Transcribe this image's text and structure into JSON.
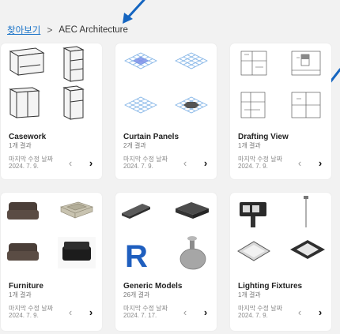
{
  "breadcrumb": {
    "home": "찾아보기",
    "separator": ">",
    "current": "AEC Architecture"
  },
  "cards": [
    {
      "title": "Casework",
      "count": "1개 결과",
      "modified_label": "마지막 수정 날짜",
      "modified_date": "2024. 7. 9."
    },
    {
      "title": "Curtain Panels",
      "count": "2개 결과",
      "modified_label": "마지막 수정 날짜",
      "modified_date": "2024. 7. 9."
    },
    {
      "title": "Drafting View",
      "count": "1개 결과",
      "modified_label": "마지막 수정 날짜",
      "modified_date": "2024. 7. 9."
    },
    {
      "title": "Furniture",
      "count": "1개 결과",
      "modified_label": "마지막 수정 날짜",
      "modified_date": "2024. 7. 9."
    },
    {
      "title": "Generic Models",
      "count": "26개 결과",
      "modified_label": "마지막 수정 날짜",
      "modified_date": "2024. 7. 17."
    },
    {
      "title": "Lighting Fixtures",
      "count": "1개 결과",
      "modified_label": "마지막 수정 날짜",
      "modified_date": "2024. 7. 9."
    }
  ],
  "nav": {
    "prev": "‹",
    "next": "›"
  },
  "colors": {
    "link": "#1a73c8",
    "annotation_arrow": "#1565c0",
    "curtain_fill": "#7b8fe8",
    "revit_blue": "#1f5fbf"
  }
}
